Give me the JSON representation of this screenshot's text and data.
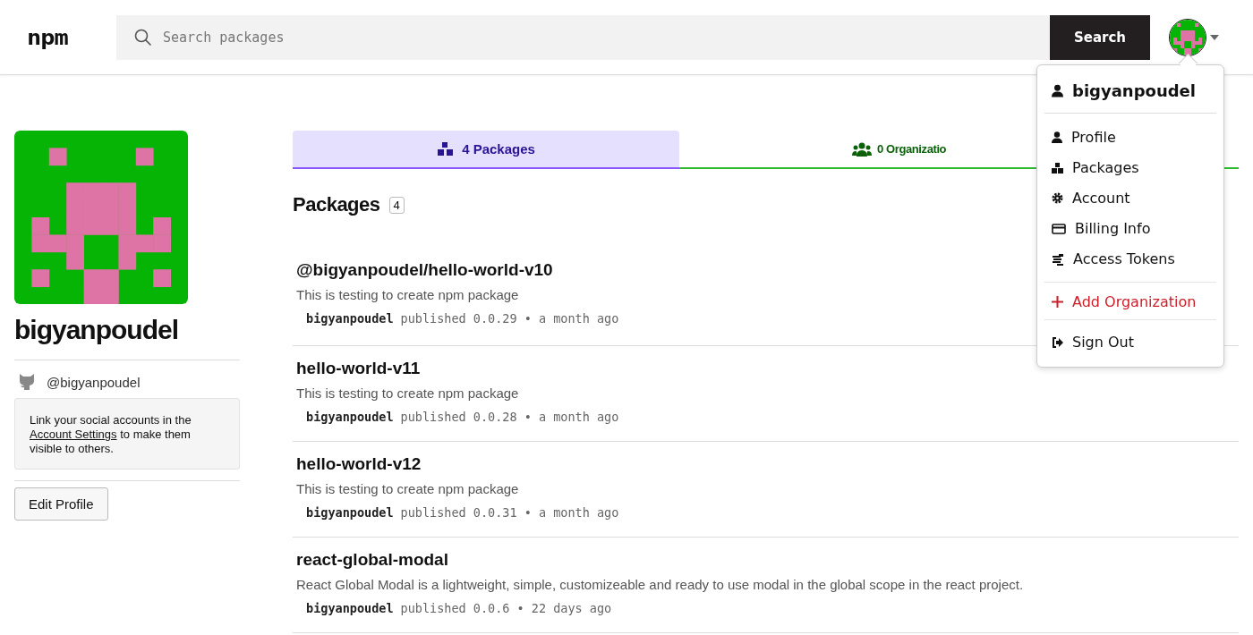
{
  "header": {
    "logo": "npm",
    "search": {
      "placeholder": "Search packages"
    },
    "search_button": "Search"
  },
  "user_menu": {
    "username": "bigyanpoudel",
    "items": [
      {
        "label": "Profile",
        "kind": "link"
      },
      {
        "label": "Packages",
        "kind": "link"
      },
      {
        "label": "Account",
        "kind": "link"
      },
      {
        "label": "Billing Info",
        "kind": "link"
      },
      {
        "label": "Access Tokens",
        "kind": "link"
      },
      {
        "label": "Add Organization",
        "kind": "add"
      },
      {
        "label": "Sign Out",
        "kind": "signout"
      }
    ]
  },
  "profile": {
    "name": "bigyanpoudel",
    "github": "@bigyanpoudel",
    "note_before": "Link your social accounts in the ",
    "note_link": "Account Settings",
    "note_after": " to make them visible to others.",
    "edit_button": "Edit Profile"
  },
  "tabs": [
    {
      "label": "4 Packages",
      "selected": true
    },
    {
      "label": "0 Organizatio",
      "selected": false
    }
  ],
  "packages": {
    "heading": "Packages",
    "count": "4",
    "items": [
      {
        "name": "@bigyanpoudel/hello-world-v10",
        "description": "This is testing to create npm package",
        "publisher": "bigyanpoudel",
        "meta": "published 0.0.29 • a month ago"
      },
      {
        "name": "hello-world-v11",
        "description": "This is testing to create npm package",
        "publisher": "bigyanpoudel",
        "meta": "published 0.0.28 • a month ago"
      },
      {
        "name": "hello-world-v12",
        "description": "This is testing to create npm package",
        "publisher": "bigyanpoudel",
        "meta": "published 0.0.31 • a month ago"
      },
      {
        "name": "react-global-modal",
        "description": "React Global Modal is a lightweight, simple, customizeable and ready to use modal in the global scope in the react project.",
        "publisher": "bigyanpoudel",
        "meta": "published 0.0.6 • 22 days ago"
      }
    ]
  }
}
